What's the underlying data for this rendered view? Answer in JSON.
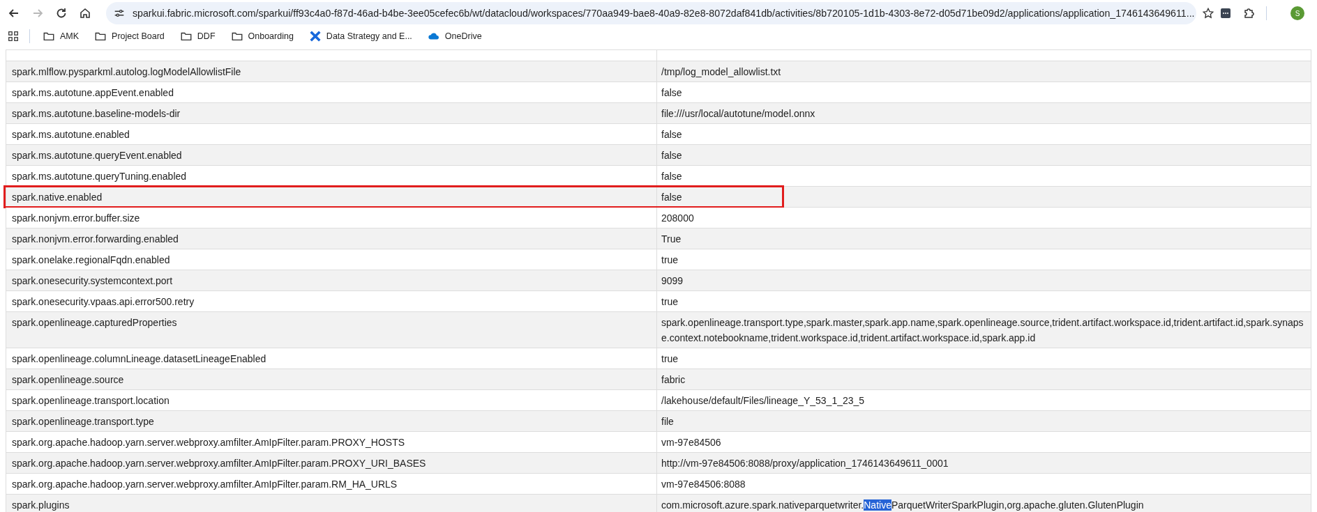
{
  "browser": {
    "url": "sparkui.fabric.microsoft.com/sparkui/ff93c4a0-f87d-46ad-b4be-3ee05cefec6b/wt/datacloud/workspaces/770aa949-bae8-40a9-82e8-8072daf841db/activities/8b720105-1d1b-4303-8e72-d05d71be09d2/applications/application_1746143649611...",
    "forward_disabled": true,
    "avatar": "S"
  },
  "bookmarks": [
    {
      "kind": "folder",
      "label": "AMK"
    },
    {
      "kind": "folder",
      "label": "Project Board"
    },
    {
      "kind": "folder",
      "label": "DDF"
    },
    {
      "kind": "folder",
      "label": "Onboarding"
    },
    {
      "kind": "app",
      "label": "Data Strategy and E..."
    },
    {
      "kind": "cloud",
      "label": "OneDrive"
    }
  ],
  "table": {
    "rows": [
      {
        "name": "spark.mlflow.pysparkml.autolog.logModelAllowlistFile",
        "value": "/tmp/log_model_allowlist.txt",
        "highlighted": false
      },
      {
        "name": "spark.ms.autotune.appEvent.enabled",
        "value": "false",
        "highlighted": false
      },
      {
        "name": "spark.ms.autotune.baseline-models-dir",
        "value": "file:///usr/local/autotune/model.onnx",
        "highlighted": false
      },
      {
        "name": "spark.ms.autotune.enabled",
        "value": "false",
        "highlighted": false
      },
      {
        "name": "spark.ms.autotune.queryEvent.enabled",
        "value": "false",
        "highlighted": false
      },
      {
        "name": "spark.ms.autotune.queryTuning.enabled",
        "value": "false",
        "highlighted": false
      },
      {
        "name": "spark.native.enabled",
        "value": "false",
        "highlighted": true
      },
      {
        "name": "spark.nonjvm.error.buffer.size",
        "value": "208000",
        "highlighted": false
      },
      {
        "name": "spark.nonjvm.error.forwarding.enabled",
        "value": "True",
        "highlighted": false
      },
      {
        "name": "spark.onelake.regionalFqdn.enabled",
        "value": "true",
        "highlighted": false
      },
      {
        "name": "spark.onesecurity.systemcontext.port",
        "value": "9099",
        "highlighted": false
      },
      {
        "name": "spark.onesecurity.vpaas.api.error500.retry",
        "value": "true",
        "highlighted": false
      },
      {
        "name": "spark.openlineage.capturedProperties",
        "value": "spark.openlineage.transport.type,spark.master,spark.app.name,spark.openlineage.source,trident.artifact.workspace.id,trident.artifact.id,spark.synapse.context.notebookname,trident.workspace.id,trident.artifact.workspace.id,spark.app.id",
        "highlighted": false
      },
      {
        "name": "spark.openlineage.columnLineage.datasetLineageEnabled",
        "value": "true",
        "highlighted": false
      },
      {
        "name": "spark.openlineage.source",
        "value": "fabric",
        "highlighted": false
      },
      {
        "name": "spark.openlineage.transport.location",
        "value": "/lakehouse/default/Files/lineage_Y_53_1_23_5",
        "highlighted": false
      },
      {
        "name": "spark.openlineage.transport.type",
        "value": "file",
        "highlighted": false
      },
      {
        "name": "spark.org.apache.hadoop.yarn.server.webproxy.amfilter.AmIpFilter.param.PROXY_HOSTS",
        "value": "vm-97e84506",
        "highlighted": false
      },
      {
        "name": "spark.org.apache.hadoop.yarn.server.webproxy.amfilter.AmIpFilter.param.PROXY_URI_BASES",
        "value": "http://vm-97e84506:8088/proxy/application_1746143649611_0001",
        "highlighted": false
      },
      {
        "name": "spark.org.apache.hadoop.yarn.server.webproxy.amfilter.AmIpFilter.param.RM_HA_URLS",
        "value": "vm-97e84506:8088",
        "highlighted": false
      },
      {
        "name": "spark.plugins",
        "value_parts": [
          {
            "text": "com.microsoft.azure.spark.nativeparquetwriter.",
            "selected": false
          },
          {
            "text": "Native",
            "selected": true
          },
          {
            "text": "ParquetWriterSparkPlugin,org.apache.gluten.GlutenPlugin",
            "selected": false
          }
        ],
        "highlighted": false
      }
    ]
  }
}
